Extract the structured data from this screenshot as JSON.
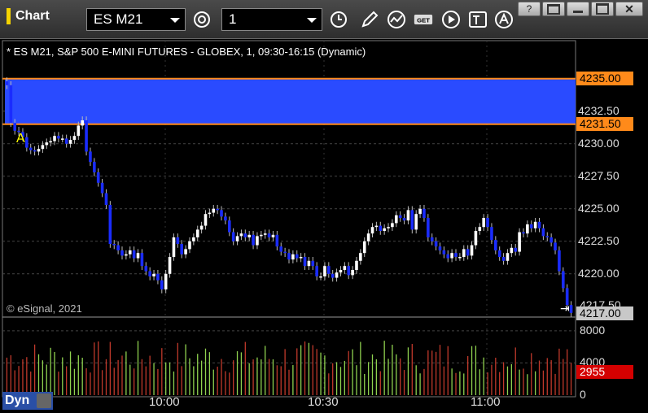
{
  "app": {
    "title": "Chart"
  },
  "toolbar": {
    "symbol_value": "ES M21",
    "interval_value": "1",
    "icons": [
      "settings-icon",
      "clock-icon",
      "pencil-icon",
      "indicator-icon",
      "get-icon",
      "play-icon",
      "text-tool-icon",
      "alert-icon"
    ]
  },
  "window_controls": [
    "help-icon",
    "restore-icon",
    "minimize-icon",
    "maximize-icon",
    "close-icon"
  ],
  "chart": {
    "header": "* ES M21, S&P 500 E-MINI FUTURES - GLOBEX, 1, 09:30-16:15 (Dynamic)",
    "copyright": "© eSignal, 2021",
    "marker": "A",
    "band_color": "#2a4bff",
    "band_top_price": 4235.0,
    "band_bottom_price": 4231.5,
    "last_price": 4217.0,
    "last_price_label": "4217.00",
    "band_top_label": "4235.00",
    "band_bottom_label": "4231.50",
    "partial_tick_label": "4217.50",
    "volume_last_label": "2955",
    "mode_label": "Dyn"
  },
  "chart_data": {
    "type": "candlestick",
    "y_ticks": [
      "4232.50",
      "4230.00",
      "4227.50",
      "4225.00",
      "4222.50",
      "4220.00"
    ],
    "y_tick_values": [
      4232.5,
      4230.0,
      4227.5,
      4225.0,
      4222.5,
      4220.0
    ],
    "ylim": [
      4216.8,
      4235.8
    ],
    "x_ticks": [
      "10:00",
      "10:30",
      "11:00"
    ],
    "volume_ticks": [
      "8000",
      "4000",
      "0"
    ],
    "volume_tick_values": [
      8000,
      4000,
      0
    ],
    "volume_ylim": [
      0,
      9500
    ],
    "closes": [
      4234.5,
      4231.6,
      4231.0,
      4230.9,
      4230.5,
      4229.7,
      4229.5,
      4229.4,
      4229.6,
      4229.9,
      4230.1,
      4230.2,
      4230.6,
      4230.4,
      4230.4,
      4230.0,
      4230.3,
      4230.6,
      4231.4,
      4231.8,
      4229.4,
      4228.6,
      4227.8,
      4227.0,
      4226.2,
      4225.3,
      4222.3,
      4222.2,
      4221.8,
      4221.4,
      4221.5,
      4221.8,
      4221.2,
      4221.6,
      4220.6,
      4220.2,
      4219.8,
      4220.0,
      4219.5,
      4218.8,
      4220.0,
      4221.3,
      4222.8,
      4222.3,
      4221.5,
      4221.9,
      4222.5,
      4222.8,
      4223.4,
      4223.7,
      4224.6,
      4224.7,
      4225.0,
      4224.9,
      4224.4,
      4224.1,
      4223.2,
      4222.5,
      4222.9,
      4223.1,
      4222.8,
      4223.0,
      4222.2,
      4222.9,
      4223.0,
      4223.1,
      4222.8,
      4223.0,
      4222.1,
      4221.7,
      4221.6,
      4221.1,
      4221.5,
      4221.2,
      4221.3,
      4220.6,
      4221.0,
      4220.6,
      4219.8,
      4219.8,
      4220.6,
      4220.0,
      4219.7,
      4220.1,
      4220.3,
      4220.6,
      4219.9,
      4220.3,
      4221.0,
      4221.6,
      4222.5,
      4223.1,
      4223.6,
      4223.7,
      4223.3,
      4223.5,
      4223.6,
      4223.9,
      4224.5,
      4224.3,
      4224.1,
      4224.9,
      4223.4,
      4224.6,
      4225.0,
      4224.3,
      4222.8,
      4222.5,
      4222.1,
      4221.8,
      4221.5,
      4221.2,
      4221.6,
      4221.3,
      4221.3,
      4221.9,
      4221.4,
      4222.2,
      4223.3,
      4223.6,
      4224.3,
      4223.6,
      4222.6,
      4221.8,
      4221.3,
      4221.0,
      4221.6,
      4222.0,
      4221.7,
      4223.2,
      4223.1,
      4223.8,
      4223.5,
      4224.0,
      4223.5,
      4222.9,
      4222.8,
      4222.4,
      4221.8,
      4220.2,
      4218.9,
      4217.6,
      4217.0
    ]
  }
}
